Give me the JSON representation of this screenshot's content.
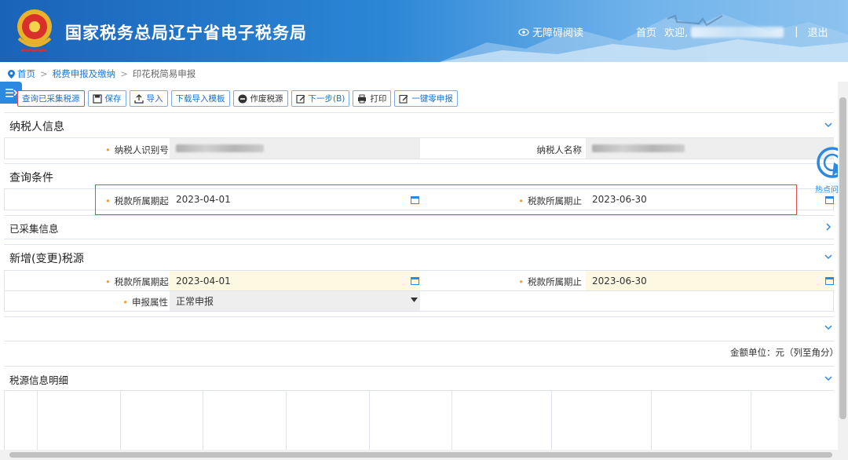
{
  "header": {
    "site_title": "国家税务总局辽宁省电子税务局",
    "accessible_label": "无障碍阅读",
    "home_label": "首页",
    "greeting": "欢迎,",
    "logout_label": "退出",
    "separator": "|"
  },
  "breadcrumb": {
    "items": [
      "首页",
      "税费申报及缴纳",
      "印花税简易申报"
    ],
    "sep": ">"
  },
  "toolbar": {
    "query_collected": "查询已采集税源",
    "save": "保存",
    "import": "导入",
    "download_template": "下载导入模板",
    "void_source": "作废税源",
    "next_step": "下一步(B)",
    "print": "打印",
    "zero_declare": "一键零申报"
  },
  "taxpayer": {
    "title": "纳税人信息",
    "id_label": "纳税人识别号",
    "name_label": "纳税人名称"
  },
  "query": {
    "title": "查询条件",
    "start_label": "税款所属期起",
    "start_value": "2023-04-01",
    "end_label": "税款所属期止",
    "end_value": "2023-06-30"
  },
  "collected": {
    "title": "已采集信息"
  },
  "new_source": {
    "title": "新增(变更)税源",
    "start_label": "税款所属期起",
    "start_value": "2023-04-01",
    "end_label": "税款所属期止",
    "end_value": "2023-06-30",
    "attr_label": "申报属性",
    "attr_value": "正常申报"
  },
  "amount_unit": "金额单位：元（列至角分）",
  "detail": {
    "title": "税源信息明细"
  },
  "hotspot_label": "热点问题",
  "colors": {
    "header_blue": "#1a63b8",
    "link_blue": "#1e78d4",
    "required_star": "#e9a23b",
    "highlight_red": "#e04a4a"
  }
}
